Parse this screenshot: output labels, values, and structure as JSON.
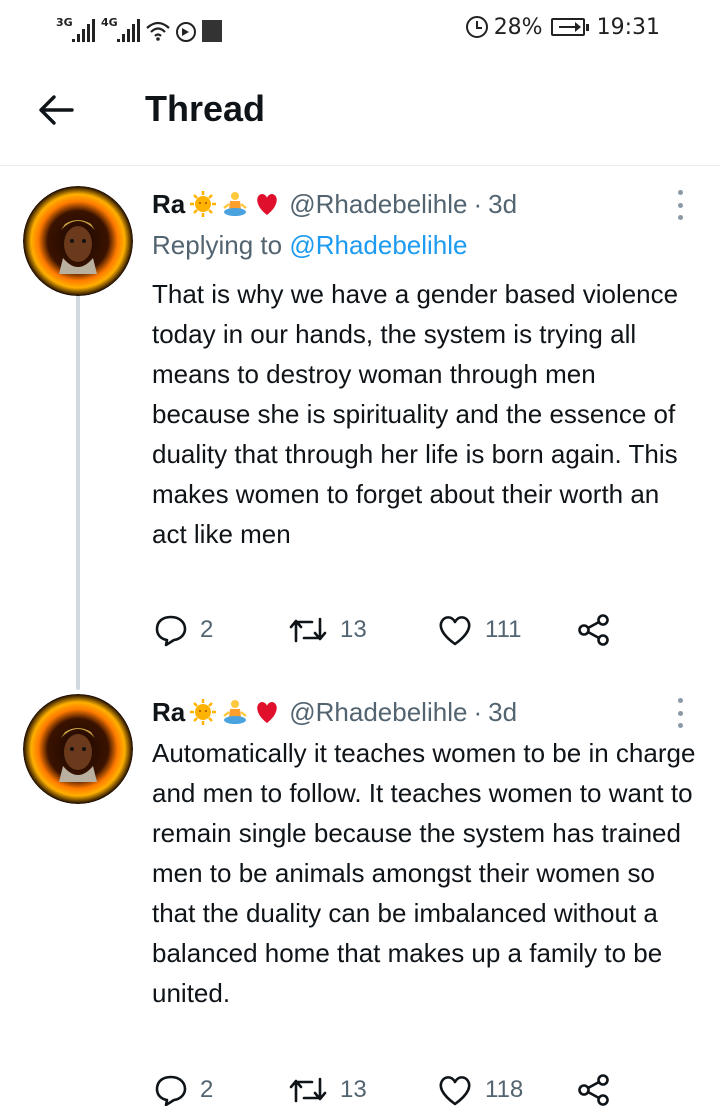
{
  "status_bar": {
    "signal1": "3G",
    "signal2": "4G",
    "battery_percent": "28%",
    "time": "19:31"
  },
  "header": {
    "title": "Thread"
  },
  "tweets": [
    {
      "name": "Ra",
      "handle": "@Rhadebelihle",
      "separator": "·",
      "age": "3d",
      "replying_prefix": "Replying to ",
      "replying_to": "@Rhadebelihle",
      "text": "That is why we have a gender based violence today in our hands, the system is trying all means to destroy woman through men because she is spirituality and the essence of duality that through her life is born again. This makes women to forget about their worth an act like men",
      "replies": "2",
      "retweets": "13",
      "likes": "111"
    },
    {
      "name": "Ra",
      "handle": "@Rhadebelihle",
      "separator": "·",
      "age": "3d",
      "text": "Automatically it teaches women to be in charge and men to follow. It teaches women to want to remain single because the system has trained men to be animals amongst their women so that the duality can be imbalanced without a balanced home that makes up a family to be united.",
      "replies": "2",
      "retweets": "13",
      "likes": "118"
    }
  ],
  "icons": {
    "back": "arrow-left-icon",
    "reply": "speech-bubble-icon",
    "retweet": "retweet-icon",
    "like": "heart-icon",
    "share": "share-icon",
    "more": "vertical-dots-icon"
  },
  "colors": {
    "link": "#1d9bf0",
    "secondary_text": "#536471",
    "thread_line": "#cfd9de"
  }
}
